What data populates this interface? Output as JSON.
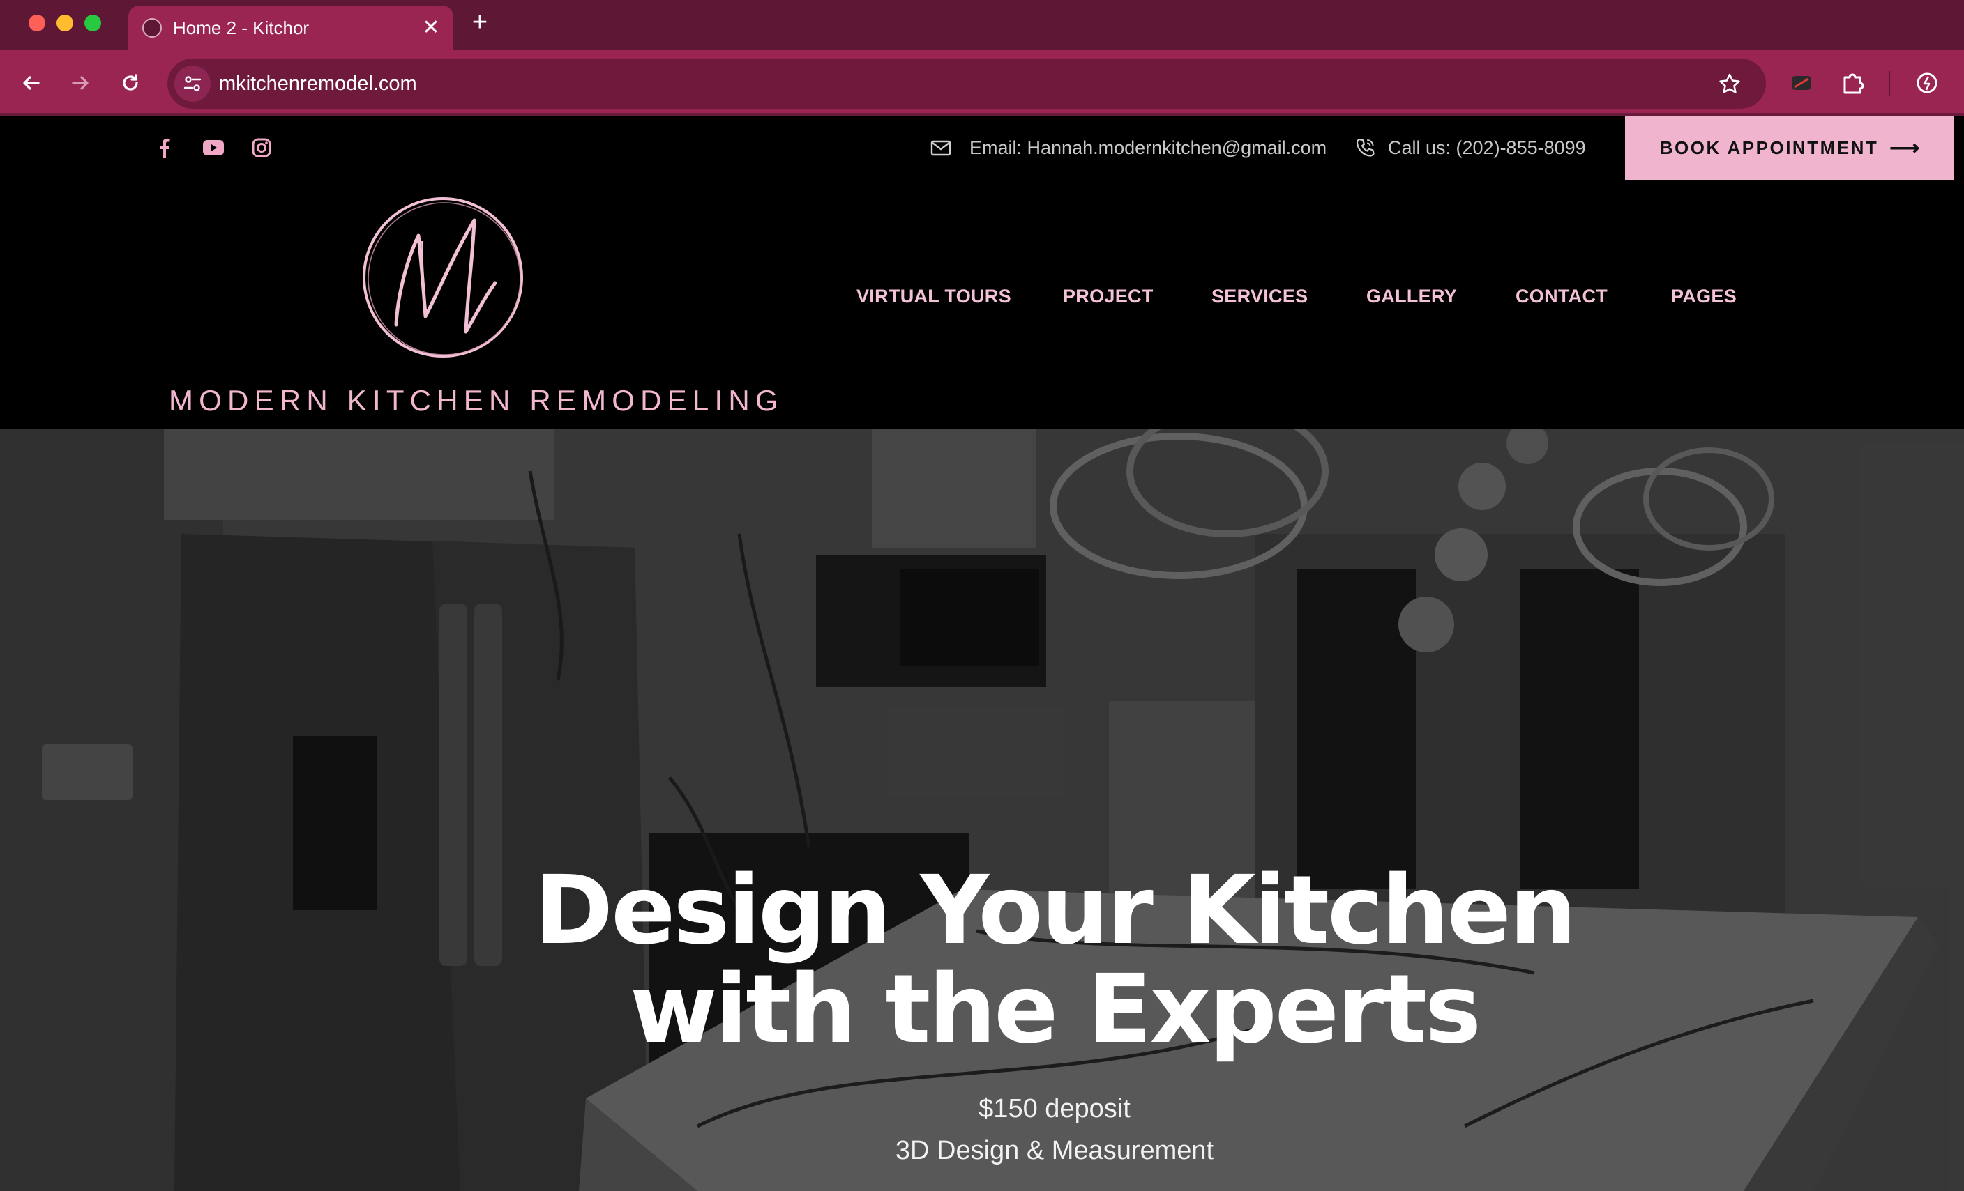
{
  "browser": {
    "tab_title": "Home 2 - Kitchor",
    "url": "mkitchenremodel.com",
    "tab_close": "✕",
    "new_tab": "+"
  },
  "topbar": {
    "email": "Email: Hannah.modernkitchen@gmail.com",
    "phone": "Call us: (202)-855-8099",
    "book_button": "BOOK APPOINTMENT",
    "book_arrow": "⟶",
    "social": [
      "facebook-icon",
      "youtube-icon",
      "instagram-icon"
    ]
  },
  "brand": {
    "name": "MODERN KITCHEN REMODELING",
    "accent_color": "#f0b4cf",
    "chrome_color": "#9a2553"
  },
  "nav": {
    "items": [
      "VIRTUAL TOURS",
      "PROJECT",
      "SERVICES",
      "GALLERY",
      "CONTACT",
      "PAGES"
    ]
  },
  "hero": {
    "title_line1": "Design Your Kitchen",
    "title_line2": "with the Experts",
    "subtitle1": "$150 deposit",
    "subtitle2": "3D Design & Measurement"
  }
}
